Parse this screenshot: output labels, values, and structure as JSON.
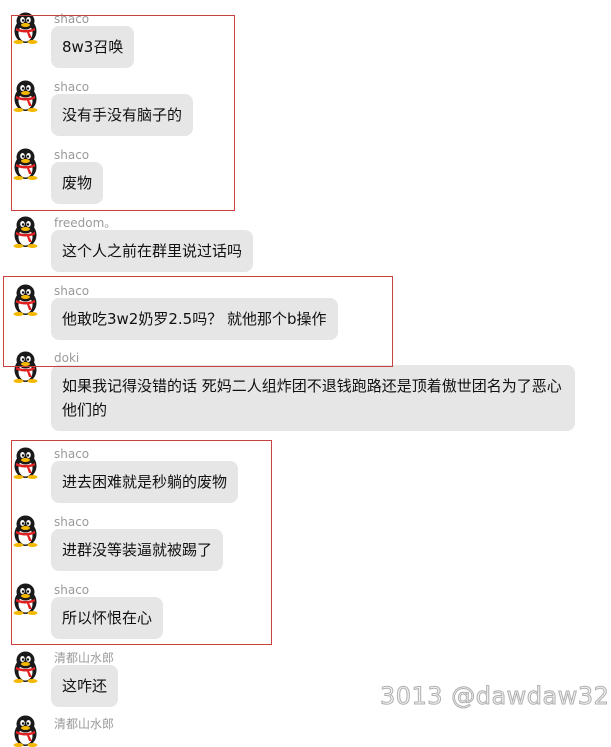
{
  "messages": [
    {
      "sender": "shaco",
      "text": "8w3召唤"
    },
    {
      "sender": "shaco",
      "text": "没有手没有脑子的"
    },
    {
      "sender": "shaco",
      "text": "废物"
    },
    {
      "sender": "freedom。",
      "text": "这个人之前在群里说过话吗"
    },
    {
      "sender": "shaco",
      "text": "他敢吃3w2奶罗2.5吗？ 就他那个b操作"
    },
    {
      "sender": "doki",
      "text": "如果我记得没错的话 死妈二人组炸团不退钱跑路还是顶着傲世团名为了恶心他们的"
    },
    {
      "sender": "shaco",
      "text": "进去困难就是秒躺的废物"
    },
    {
      "sender": "shaco",
      "text": "进群没等装逼就被踢了"
    },
    {
      "sender": "shaco",
      "text": "所以怀恨在心"
    },
    {
      "sender": "清都山水郎",
      "text": "这咋还"
    }
  ],
  "next_sender_partial": "清都山水郎",
  "watermark": "3013 @dawdaw32",
  "colors": {
    "bubble": "#e6e6e6",
    "name": "#9a9a9a",
    "highlight": "#c94040"
  }
}
